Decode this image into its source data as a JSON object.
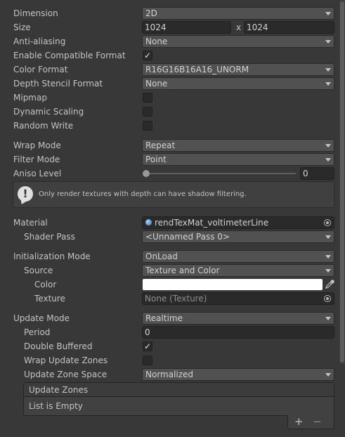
{
  "rows": {
    "dimension": {
      "label": "Dimension",
      "value": "2D"
    },
    "size": {
      "label": "Size",
      "width": "1024",
      "separator": "x",
      "height": "1024"
    },
    "anti_aliasing": {
      "label": "Anti-aliasing",
      "value": "None"
    },
    "compat_format": {
      "label": "Enable Compatible Format",
      "checked": true
    },
    "color_format": {
      "label": "Color Format",
      "value": "R16G16B16A16_UNORM"
    },
    "depth_stencil": {
      "label": "Depth Stencil Format",
      "value": "None"
    },
    "mipmap": {
      "label": "Mipmap",
      "checked": false
    },
    "dynamic_scaling": {
      "label": "Dynamic Scaling",
      "checked": false
    },
    "random_write": {
      "label": "Random Write",
      "checked": false
    },
    "wrap_mode": {
      "label": "Wrap Mode",
      "value": "Repeat"
    },
    "filter_mode": {
      "label": "Filter Mode",
      "value": "Point"
    },
    "aniso_level": {
      "label": "Aniso Level",
      "value": "0",
      "slider_fraction": 0
    }
  },
  "help": {
    "text": "Only render textures with depth can have shadow filtering."
  },
  "material": {
    "label": "Material",
    "value": "rendTexMat_voltimeterLine"
  },
  "shader_pass": {
    "label": "Shader Pass",
    "value": "<Unnamed Pass 0>"
  },
  "init_mode": {
    "label": "Initialization Mode",
    "value": "OnLoad"
  },
  "source": {
    "label": "Source",
    "value": "Texture and Color"
  },
  "color": {
    "label": "Color",
    "value": "#ffffff"
  },
  "texture": {
    "label": "Texture",
    "value": "None (Texture)"
  },
  "update_mode": {
    "label": "Update Mode",
    "value": "Realtime"
  },
  "period": {
    "label": "Period",
    "value": "0"
  },
  "double_buffered": {
    "label": "Double Buffered",
    "checked": true
  },
  "wrap_update_zones": {
    "label": "Wrap Update Zones",
    "checked": false
  },
  "update_zone_space": {
    "label": "Update Zone Space",
    "value": "Normalized"
  },
  "update_zones": {
    "header": "Update Zones",
    "empty_text": "List is Empty",
    "add": "+",
    "remove": "−"
  },
  "icons": {
    "check": "✓",
    "dropdown": "chevron-down-icon",
    "object_picker": "object-picker-icon",
    "eyedropper": "eyedropper-icon",
    "help": "warning-help-icon",
    "material": "material-sphere-icon"
  },
  "colors": {
    "panel_bg": "#383838",
    "field_bg": "#2a2a2a",
    "dropdown_bg": "#515151",
    "text": "#c4c4c4"
  }
}
